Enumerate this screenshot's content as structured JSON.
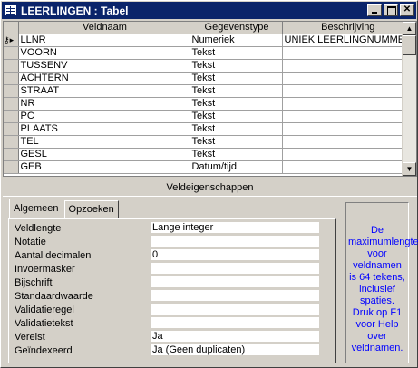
{
  "window": {
    "title": "LEERLINGEN : Tabel"
  },
  "grid": {
    "columns": [
      "Veldnaam",
      "Gegevenstype",
      "Beschrijving"
    ],
    "rows": [
      {
        "name": "LLNR",
        "type": "Numeriek",
        "desc": "UNIEK LEERLINGNUMMER"
      },
      {
        "name": "VOORN",
        "type": "Tekst",
        "desc": ""
      },
      {
        "name": "TUSSENV",
        "type": "Tekst",
        "desc": ""
      },
      {
        "name": "ACHTERN",
        "type": "Tekst",
        "desc": ""
      },
      {
        "name": "STRAAT",
        "type": "Tekst",
        "desc": ""
      },
      {
        "name": "NR",
        "type": "Tekst",
        "desc": ""
      },
      {
        "name": "PC",
        "type": "Tekst",
        "desc": ""
      },
      {
        "name": "PLAATS",
        "type": "Tekst",
        "desc": ""
      },
      {
        "name": "TEL",
        "type": "Tekst",
        "desc": ""
      },
      {
        "name": "GESL",
        "type": "Tekst",
        "desc": ""
      },
      {
        "name": "GEB",
        "type": "Datum/tijd",
        "desc": ""
      }
    ]
  },
  "props": {
    "header": "Veldeigenschappen",
    "tabs": [
      "Algemeen",
      "Opzoeken"
    ],
    "rows": [
      {
        "label": "Veldlengte",
        "value": "Lange integer"
      },
      {
        "label": "Notatie",
        "value": ""
      },
      {
        "label": "Aantal decimalen",
        "value": "0"
      },
      {
        "label": "Invoermasker",
        "value": ""
      },
      {
        "label": "Bijschrift",
        "value": ""
      },
      {
        "label": "Standaardwaarde",
        "value": ""
      },
      {
        "label": "Validatieregel",
        "value": ""
      },
      {
        "label": "Validatietekst",
        "value": ""
      },
      {
        "label": "Vereist",
        "value": "Ja"
      },
      {
        "label": "Geïndexeerd",
        "value": "Ja (Geen duplicaten)"
      }
    ],
    "help_text": "De maximumlengte voor veldnamen is 64 tekens, inclusief spaties. Druk op F1 voor Help over veldnamen."
  }
}
